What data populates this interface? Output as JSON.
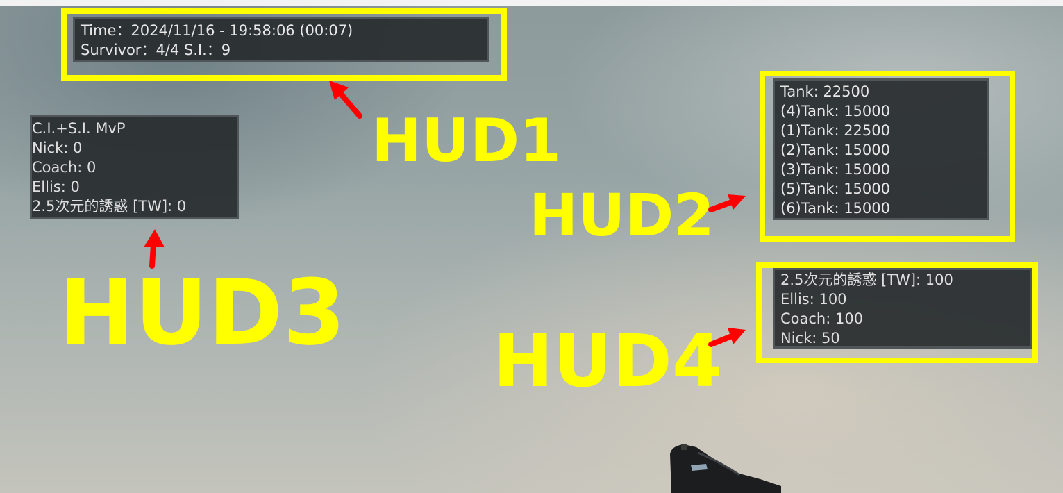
{
  "hud1": {
    "time_line": "Time：2024/11/16 - 19:58:06 (00:07)",
    "status_line": "Survivor：4/4  S.I.：9"
  },
  "hud2": {
    "lines": [
      "Tank: 22500",
      "(4)Tank: 15000",
      "(1)Tank: 22500",
      "(2)Tank: 15000",
      "(3)Tank: 15000",
      "(5)Tank: 15000",
      "(6)Tank: 15000"
    ]
  },
  "hud3": {
    "title": "C.I.+S.I. MvP",
    "rows": [
      "Nick: 0",
      "Coach: 0",
      "Ellis: 0",
      "2.5次元的誘惑 [TW]: 0"
    ]
  },
  "hud4": {
    "rows": [
      "2.5次元的誘惑 [TW]: 100",
      "Ellis: 100",
      "Coach: 100",
      "Nick: 50"
    ]
  },
  "annotations": {
    "hud1_label": "HUD1",
    "hud2_label": "HUD2",
    "hud3_label": "HUD3",
    "hud4_label": "HUD4",
    "highlight_color": "#ffff00",
    "arrow_color": "#ff0000"
  },
  "icons": {
    "weapon": "pistol-icon",
    "arrow": "arrow-icon"
  }
}
